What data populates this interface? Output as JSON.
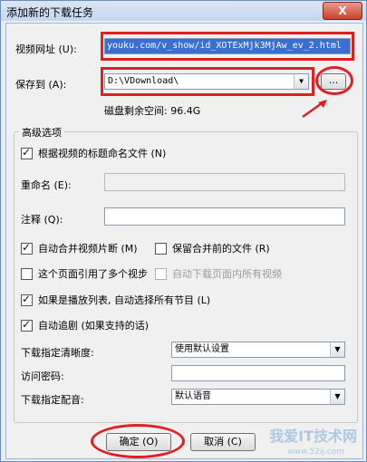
{
  "window": {
    "title": "添加新的下载任务",
    "close_label": "X"
  },
  "url_field": {
    "label": "视频网址 (U):",
    "value": "youku.com/v_show/id_XOTExMjk3MjAw_ev_2.html"
  },
  "save_to": {
    "label": "保存到 (A):",
    "value": "D:\\VDownload\\",
    "browse_label": "..."
  },
  "disk_space": {
    "text": "磁盘剩余空间: 96.4G"
  },
  "advanced": {
    "title": "高级选项",
    "name_by_title": {
      "label": "根据视频的标题命名文件 (N)",
      "checked": true
    },
    "rename": {
      "label": "重命名 (E):",
      "value": ""
    },
    "comment": {
      "label": "注释 (Q):",
      "value": ""
    },
    "auto_merge": {
      "label": "自动合并视频片断 (M)",
      "checked": true
    },
    "keep_before_merge": {
      "label": "保留合并前的文件 (R)",
      "checked": false
    },
    "multi_video": {
      "label": "这个页面引用了多个视步",
      "checked": false
    },
    "auto_download_all": {
      "label": "自动下载页面内所有视频",
      "checked": false
    },
    "playlist_select_all": {
      "label": "如果是播放列表, 自动选择所有节目 (L)",
      "checked": true
    },
    "auto_follow": {
      "label": "自动追剧 (如果支持的话)",
      "checked": true
    },
    "quality": {
      "label": "下载指定清晰度:",
      "value": "使用默认设置"
    },
    "password": {
      "label": "访问密码:",
      "value": ""
    },
    "dubbing": {
      "label": "下载指定配音:",
      "value": "默认语音"
    }
  },
  "buttons": {
    "ok": "确定 (O)",
    "cancel": "取消 (C)"
  },
  "watermark": {
    "text": "我爱IT技术网",
    "url": "www.52ij.com"
  }
}
